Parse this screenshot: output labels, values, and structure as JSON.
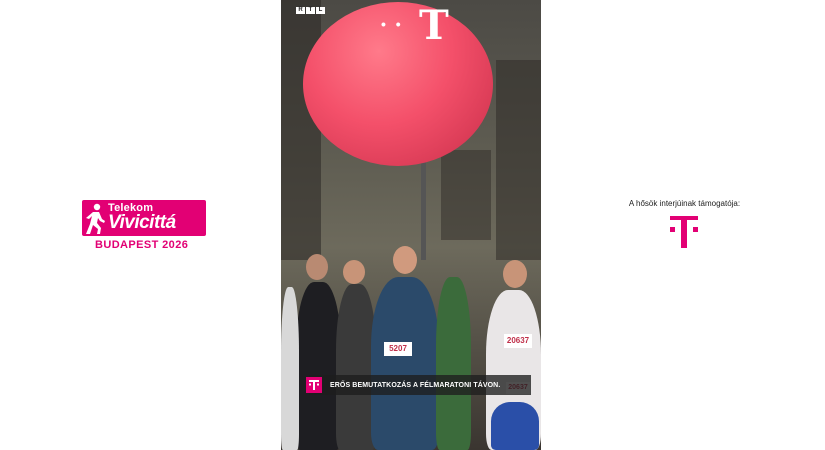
{
  "event_logo": {
    "line1": "Telekom",
    "line2": "Vivicittá",
    "line3": "BUDAPEST 2026"
  },
  "sponsor": {
    "text": "A hősök interjúinak támogatója:"
  },
  "video": {
    "channel_logo_letters": [
      "R",
      "T",
      "L"
    ],
    "caption": "ERŐS BEMUTATKOZÁS A FÉLMARATONI TÁVON.",
    "bibs": [
      "20637",
      "20637",
      "5207"
    ]
  },
  "colors": {
    "brand_magenta": "#e20074"
  }
}
